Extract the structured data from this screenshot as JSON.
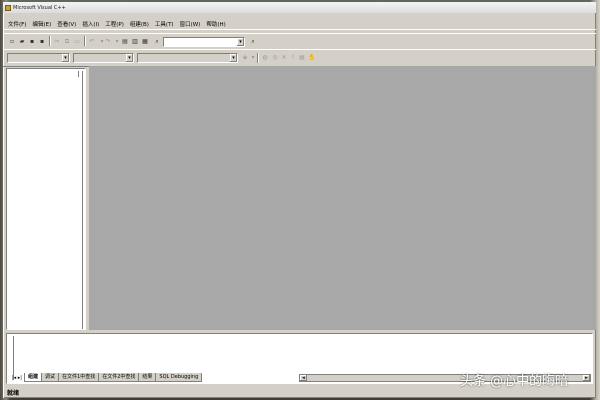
{
  "window": {
    "title": "Microsoft Visual C++"
  },
  "menu": [
    {
      "label": "文件(F)"
    },
    {
      "label": "编辑(E)"
    },
    {
      "label": "查看(V)"
    },
    {
      "label": "插入(I)"
    },
    {
      "label": "工程(P)"
    },
    {
      "label": "组建(B)"
    },
    {
      "label": "工具(T)"
    },
    {
      "label": "窗口(W)"
    },
    {
      "label": "帮助(H)"
    }
  ],
  "toolbar": {
    "find_combo_value": ""
  },
  "wizard_bar": {
    "class_combo_value": "",
    "filter_combo_value": "",
    "members_combo_value": ""
  },
  "output": {
    "tabs": [
      {
        "label": "组建",
        "active": true
      },
      {
        "label": "调试",
        "active": false
      },
      {
        "label": "在文件1中查找",
        "active": false
      },
      {
        "label": "在文件2中查找",
        "active": false
      },
      {
        "label": "结果",
        "active": false
      },
      {
        "label": "SQL Debugging",
        "active": false
      }
    ]
  },
  "status": {
    "text": "就绪"
  },
  "watermark": {
    "text": "头条 @心中的晦暗"
  },
  "colors": {
    "mdi_background": "#a8a8a8",
    "face": "#d4d0c8"
  }
}
